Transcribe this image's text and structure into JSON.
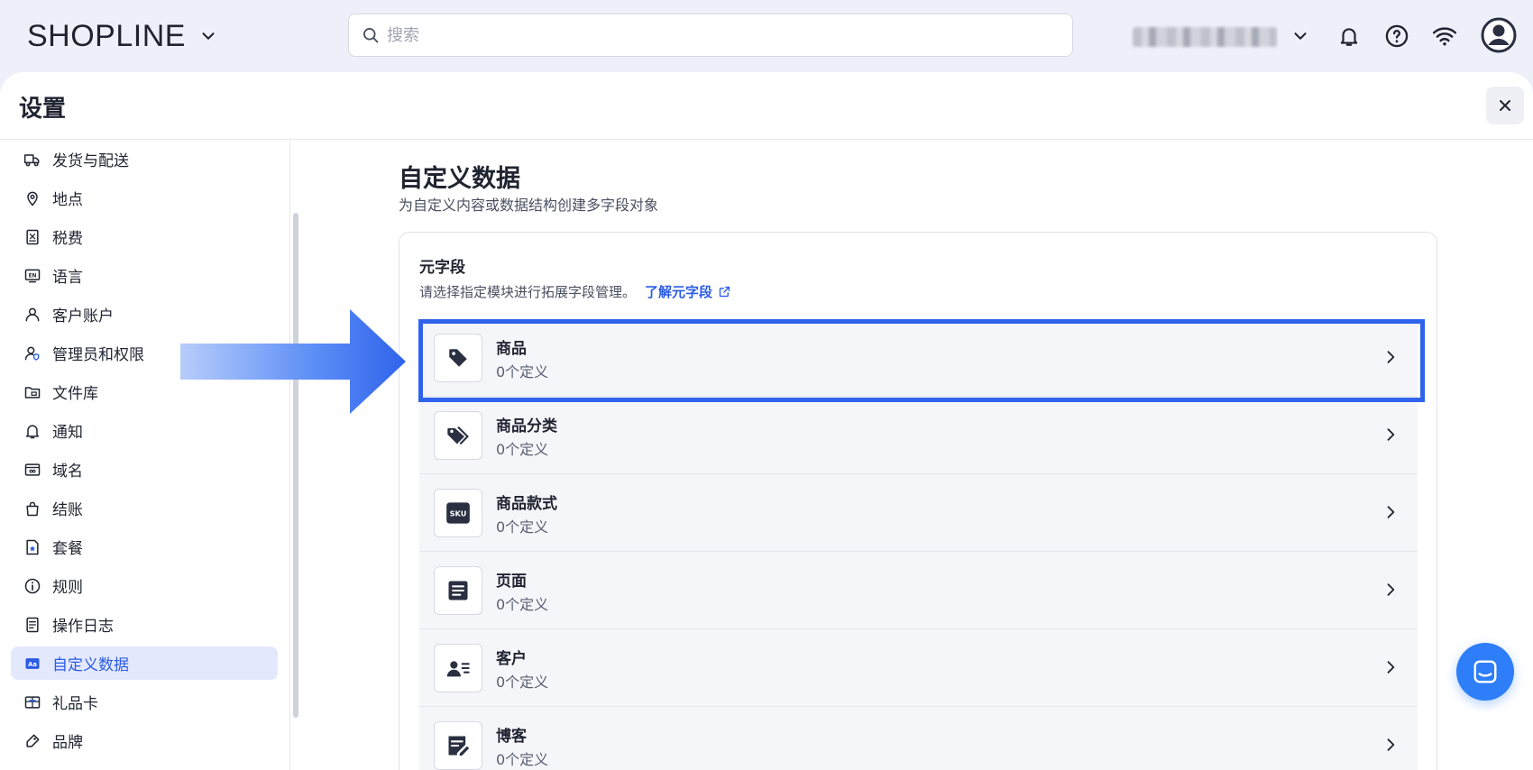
{
  "app": {
    "logo_text": "SHOPLINE"
  },
  "search": {
    "placeholder": "搜索",
    "value": ""
  },
  "settings": {
    "title": "设置"
  },
  "sidebar": {
    "items": [
      {
        "label": "发货与配送",
        "icon": "truck-icon"
      },
      {
        "label": "地点",
        "icon": "location-pin-icon"
      },
      {
        "label": "税费",
        "icon": "tax-receipt-icon"
      },
      {
        "label": "语言",
        "icon": "language-icon"
      },
      {
        "label": "客户账户",
        "icon": "user-icon"
      },
      {
        "label": "管理员和权限",
        "icon": "user-shield-icon"
      },
      {
        "label": "文件库",
        "icon": "folder-icon"
      },
      {
        "label": "通知",
        "icon": "bell-icon"
      },
      {
        "label": "域名",
        "icon": "domain-icon"
      },
      {
        "label": "结账",
        "icon": "shopping-bag-icon"
      },
      {
        "label": "套餐",
        "icon": "plan-icon"
      },
      {
        "label": "规则",
        "icon": "info-icon"
      },
      {
        "label": "操作日志",
        "icon": "log-icon"
      },
      {
        "label": "自定义数据",
        "icon": "custom-data-icon",
        "active": true
      },
      {
        "label": "礼品卡",
        "icon": "gift-card-icon"
      },
      {
        "label": "品牌",
        "icon": "brand-icon"
      }
    ]
  },
  "main": {
    "title": "自定义数据",
    "subtitle": "为自定义内容或数据结构创建多字段对象",
    "metafields": {
      "title": "元字段",
      "description": "请选择指定模块进行拓展字段管理。",
      "learn_link": "了解元字段",
      "rows": [
        {
          "name": "商品",
          "count": "0个定义",
          "icon": "tag-icon"
        },
        {
          "name": "商品分类",
          "count": "0个定义",
          "icon": "tags-icon"
        },
        {
          "name": "商品款式",
          "count": "0个定义",
          "icon": "sku-icon",
          "icon_text": "SKU"
        },
        {
          "name": "页面",
          "count": "0个定义",
          "icon": "page-icon"
        },
        {
          "name": "客户",
          "count": "0个定义",
          "icon": "customer-card-icon"
        },
        {
          "name": "博客",
          "count": "0个定义",
          "icon": "blog-edit-icon"
        }
      ]
    }
  },
  "colors": {
    "accent": "#2c5ce6",
    "highlight": "#2f63eb",
    "chat": "#2d7ef8"
  }
}
